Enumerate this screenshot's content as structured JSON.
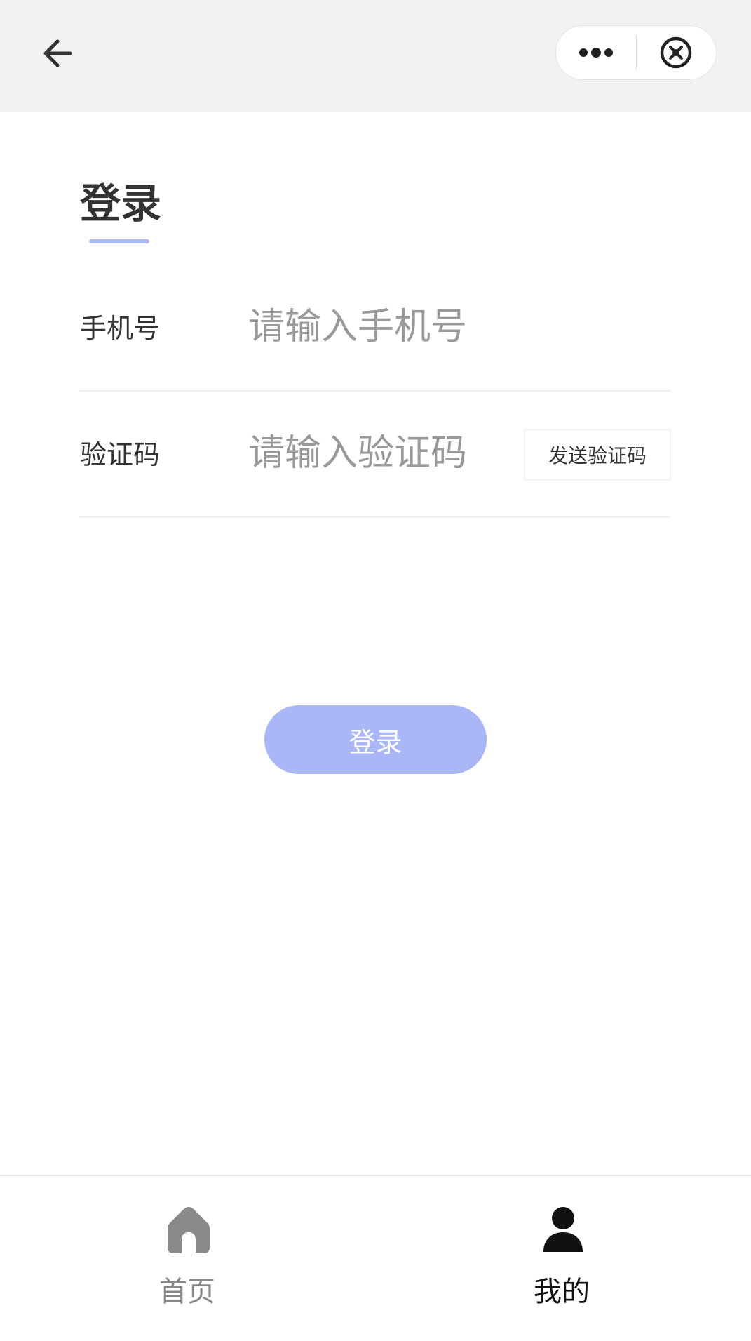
{
  "navbar": {
    "back_icon": "arrow-left-icon",
    "more_icon": "more-dots-icon",
    "close_icon": "close-circle-icon"
  },
  "page": {
    "title": "登录",
    "accent_color": "#a9b7f7"
  },
  "form": {
    "phone": {
      "label": "手机号",
      "placeholder": "请输入手机号",
      "value": ""
    },
    "code": {
      "label": "验证码",
      "placeholder": "请输入验证码",
      "value": "",
      "send_button_label": "发送验证码"
    },
    "submit_label": "登录"
  },
  "tabbar": {
    "tabs": [
      {
        "label": "首页",
        "icon": "home-icon",
        "active": false
      },
      {
        "label": "我的",
        "icon": "user-icon",
        "active": true
      }
    ]
  }
}
